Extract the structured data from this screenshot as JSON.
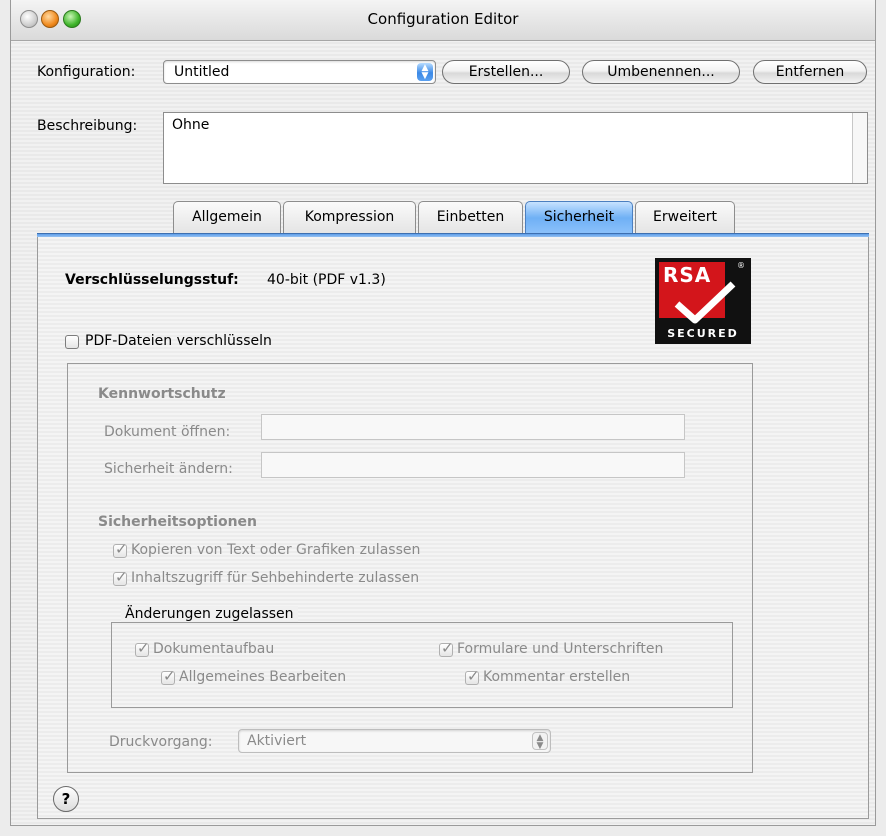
{
  "window": {
    "title": "Configuration Editor"
  },
  "config": {
    "label": "Konfiguration:",
    "selected": "Untitled",
    "buttons": {
      "create": "Erstellen...",
      "rename": "Umbenennen...",
      "remove": "Entfernen"
    }
  },
  "description": {
    "label": "Beschreibung:",
    "value": "Ohne"
  },
  "tabs": [
    {
      "label": "Allgemein"
    },
    {
      "label": "Kompression"
    },
    {
      "label": "Einbetten"
    },
    {
      "label": "Sicherheit",
      "active": true
    },
    {
      "label": "Erweitert"
    }
  ],
  "security": {
    "encryption_level_label": "Verschlüsselungsstuf:",
    "encryption_level_value": "40-bit (PDF v1.3)",
    "rsa_logo": {
      "brand": "RSA",
      "caption": "SECURED",
      "mark": "®"
    },
    "encrypt_checkbox": {
      "label": "PDF-Dateien verschlüsseln",
      "checked": false
    },
    "password": {
      "heading": "Kennwortschutz",
      "open_label": "Dokument öffnen:",
      "open_value": "",
      "change_label": "Sicherheit ändern:",
      "change_value": ""
    },
    "options": {
      "heading": "Sicherheitsoptionen",
      "copy": {
        "label": "Kopieren von Text oder Grafiken zulassen",
        "checked": true
      },
      "access": {
        "label": "Inhaltszugriff für Sehbehinderte zulassen",
        "checked": true
      }
    },
    "changes": {
      "heading": "Änderungen zugelassen",
      "assembly": {
        "label": "Dokumentaufbau",
        "checked": true
      },
      "general_edit": {
        "label": "Allgemeines Bearbeiten",
        "checked": true
      },
      "forms": {
        "label": "Formulare und Unterschriften",
        "checked": true
      },
      "comments": {
        "label": "Kommentar erstellen",
        "checked": true
      }
    },
    "printing": {
      "label": "Druckvorgang:",
      "value": "Aktiviert"
    }
  },
  "help": {
    "glyph": "?"
  }
}
